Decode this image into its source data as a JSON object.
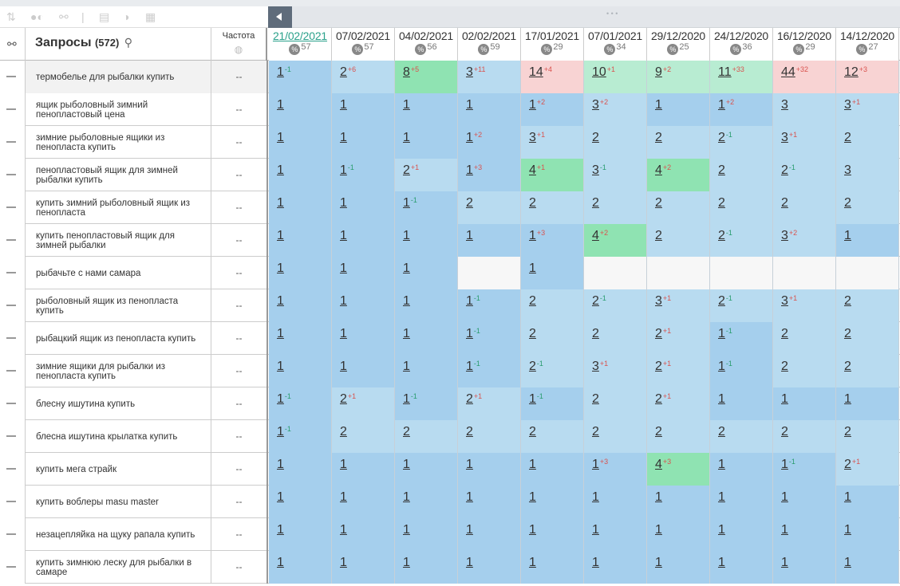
{
  "toolbar": {
    "icons": [
      "sort-icon",
      "toggle-icon",
      "link-icon",
      "table-icon",
      "contrast-icon",
      "text-icon"
    ]
  },
  "header": {
    "link_icon": "link-icon",
    "queries_label": "Запросы",
    "queries_count": "(572)",
    "frequency_label": "Частота",
    "frequency_icon": "globe-icon",
    "dates": [
      {
        "date": "21/02/2021",
        "num": "57",
        "active": true
      },
      {
        "date": "07/02/2021",
        "num": "57"
      },
      {
        "date": "04/02/2021",
        "num": "56"
      },
      {
        "date": "02/02/2021",
        "num": "59"
      },
      {
        "date": "17/01/2021",
        "num": "29"
      },
      {
        "date": "07/01/2021",
        "num": "34"
      },
      {
        "date": "29/12/2020",
        "num": "25"
      },
      {
        "date": "24/12/2020",
        "num": "36"
      },
      {
        "date": "16/12/2020",
        "num": "29"
      },
      {
        "date": "14/12/2020",
        "num": "27"
      }
    ]
  },
  "rows": [
    {
      "q": "термобелье для рыбалки купить",
      "f": "--",
      "cells": [
        [
          "1",
          "-1",
          "blue"
        ],
        [
          "2",
          "+6",
          "lblue"
        ],
        [
          "8",
          "+5",
          "green"
        ],
        [
          "3",
          "+11",
          "lblue"
        ],
        [
          "14",
          "+4",
          "pink"
        ],
        [
          "10",
          "+1",
          "lgreen"
        ],
        [
          "9",
          "+2",
          "lgreen"
        ],
        [
          "11",
          "+33",
          "lgreen"
        ],
        [
          "44",
          "+32",
          "pink"
        ],
        [
          "12",
          "+3",
          "pink"
        ]
      ]
    },
    {
      "q": "ящик рыболовный зимний пенопластовый цена",
      "f": "--",
      "cells": [
        [
          "1",
          "",
          "blue"
        ],
        [
          "1",
          "",
          "blue"
        ],
        [
          "1",
          "",
          "blue"
        ],
        [
          "1",
          "",
          "blue"
        ],
        [
          "1",
          "+2",
          "blue"
        ],
        [
          "3",
          "+2",
          "lblue"
        ],
        [
          "1",
          "",
          "blue"
        ],
        [
          "1",
          "+2",
          "blue"
        ],
        [
          "3",
          "",
          "lblue"
        ],
        [
          "3",
          "+1",
          "lblue"
        ]
      ]
    },
    {
      "q": "зимние рыболовные ящики из пенопласта купить",
      "f": "--",
      "cells": [
        [
          "1",
          "",
          "blue"
        ],
        [
          "1",
          "",
          "blue"
        ],
        [
          "1",
          "",
          "blue"
        ],
        [
          "1",
          "+2",
          "blue"
        ],
        [
          "3",
          "+1",
          "lblue"
        ],
        [
          "2",
          "",
          "lblue"
        ],
        [
          "2",
          "",
          "lblue"
        ],
        [
          "2",
          "-1",
          "lblue"
        ],
        [
          "3",
          "+1",
          "lblue"
        ],
        [
          "2",
          "",
          "lblue"
        ]
      ]
    },
    {
      "q": "пенопластовый ящик для зимней рыбалки купить",
      "f": "--",
      "cells": [
        [
          "1",
          "",
          "blue"
        ],
        [
          "1",
          "-1",
          "blue"
        ],
        [
          "2",
          "+1",
          "lblue"
        ],
        [
          "1",
          "+3",
          "blue"
        ],
        [
          "4",
          "+1",
          "green"
        ],
        [
          "3",
          "-1",
          "lblue"
        ],
        [
          "4",
          "+2",
          "green"
        ],
        [
          "2",
          "",
          "lblue"
        ],
        [
          "2",
          "-1",
          "lblue"
        ],
        [
          "3",
          "",
          "lblue"
        ]
      ]
    },
    {
      "q": "купить зимний рыболовный ящик из пенопласта",
      "f": "--",
      "cells": [
        [
          "1",
          "",
          "blue"
        ],
        [
          "1",
          "",
          "blue"
        ],
        [
          "1",
          "-1",
          "blue"
        ],
        [
          "2",
          "",
          "lblue"
        ],
        [
          "2",
          "",
          "lblue"
        ],
        [
          "2",
          "",
          "lblue"
        ],
        [
          "2",
          "",
          "lblue"
        ],
        [
          "2",
          "",
          "lblue"
        ],
        [
          "2",
          "",
          "lblue"
        ],
        [
          "2",
          "",
          "lblue"
        ]
      ]
    },
    {
      "q": "купить пенопластовый ящик для зимней рыбалки",
      "f": "--",
      "cells": [
        [
          "1",
          "",
          "blue"
        ],
        [
          "1",
          "",
          "blue"
        ],
        [
          "1",
          "",
          "blue"
        ],
        [
          "1",
          "",
          "blue"
        ],
        [
          "1",
          "+3",
          "blue"
        ],
        [
          "4",
          "+2",
          "green"
        ],
        [
          "2",
          "",
          "lblue"
        ],
        [
          "2",
          "-1",
          "lblue"
        ],
        [
          "3",
          "+2",
          "lblue"
        ],
        [
          "1",
          "",
          "blue"
        ]
      ]
    },
    {
      "q": "рыбачьте с нами самара",
      "f": "--",
      "cells": [
        [
          "1",
          "",
          "blue"
        ],
        [
          "1",
          "",
          "blue"
        ],
        [
          "1",
          "",
          "blue"
        ],
        [
          "",
          "",
          "empty"
        ],
        [
          "1",
          "",
          "blue"
        ],
        [
          "",
          "",
          "empty"
        ],
        [
          "",
          "",
          "empty"
        ],
        [
          "",
          "",
          "empty"
        ],
        [
          "",
          "",
          "empty"
        ],
        [
          "",
          "",
          "empty"
        ]
      ]
    },
    {
      "q": "рыболовный ящик из пенопласта купить",
      "f": "--",
      "cells": [
        [
          "1",
          "",
          "blue"
        ],
        [
          "1",
          "",
          "blue"
        ],
        [
          "1",
          "",
          "blue"
        ],
        [
          "1",
          "-1",
          "blue"
        ],
        [
          "2",
          "",
          "lblue"
        ],
        [
          "2",
          "-1",
          "lblue"
        ],
        [
          "3",
          "+1",
          "lblue"
        ],
        [
          "2",
          "-1",
          "lblue"
        ],
        [
          "3",
          "+1",
          "lblue"
        ],
        [
          "2",
          "",
          "lblue"
        ]
      ]
    },
    {
      "q": "рыбацкий ящик из пенопласта купить",
      "f": "--",
      "cells": [
        [
          "1",
          "",
          "blue"
        ],
        [
          "1",
          "",
          "blue"
        ],
        [
          "1",
          "",
          "blue"
        ],
        [
          "1",
          "-1",
          "blue"
        ],
        [
          "2",
          "",
          "lblue"
        ],
        [
          "2",
          "",
          "lblue"
        ],
        [
          "2",
          "+1",
          "lblue"
        ],
        [
          "1",
          "-1",
          "blue"
        ],
        [
          "2",
          "",
          "lblue"
        ],
        [
          "2",
          "",
          "lblue"
        ]
      ]
    },
    {
      "q": "зимние ящики для рыбалки из пенопласта купить",
      "f": "--",
      "cells": [
        [
          "1",
          "",
          "blue"
        ],
        [
          "1",
          "",
          "blue"
        ],
        [
          "1",
          "",
          "blue"
        ],
        [
          "1",
          "-1",
          "blue"
        ],
        [
          "2",
          "-1",
          "lblue"
        ],
        [
          "3",
          "+1",
          "lblue"
        ],
        [
          "2",
          "+1",
          "lblue"
        ],
        [
          "1",
          "-1",
          "blue"
        ],
        [
          "2",
          "",
          "lblue"
        ],
        [
          "2",
          "",
          "lblue"
        ]
      ]
    },
    {
      "q": "блесну ишутина купить",
      "f": "--",
      "cells": [
        [
          "1",
          "-1",
          "blue"
        ],
        [
          "2",
          "+1",
          "lblue"
        ],
        [
          "1",
          "-1",
          "blue"
        ],
        [
          "2",
          "+1",
          "lblue"
        ],
        [
          "1",
          "-1",
          "blue"
        ],
        [
          "2",
          "",
          "lblue"
        ],
        [
          "2",
          "+1",
          "lblue"
        ],
        [
          "1",
          "",
          "blue"
        ],
        [
          "1",
          "",
          "blue"
        ],
        [
          "1",
          "",
          "blue"
        ]
      ]
    },
    {
      "q": "блесна ишутина крылатка купить",
      "f": "--",
      "cells": [
        [
          "1",
          "-1",
          "blue"
        ],
        [
          "2",
          "",
          "lblue"
        ],
        [
          "2",
          "",
          "lblue"
        ],
        [
          "2",
          "",
          "lblue"
        ],
        [
          "2",
          "",
          "lblue"
        ],
        [
          "2",
          "",
          "lblue"
        ],
        [
          "2",
          "",
          "lblue"
        ],
        [
          "2",
          "",
          "lblue"
        ],
        [
          "2",
          "",
          "lblue"
        ],
        [
          "2",
          "",
          "lblue"
        ]
      ]
    },
    {
      "q": "купить мега страйк",
      "f": "--",
      "cells": [
        [
          "1",
          "",
          "blue"
        ],
        [
          "1",
          "",
          "blue"
        ],
        [
          "1",
          "",
          "blue"
        ],
        [
          "1",
          "",
          "blue"
        ],
        [
          "1",
          "",
          "blue"
        ],
        [
          "1",
          "+3",
          "blue"
        ],
        [
          "4",
          "+3",
          "green"
        ],
        [
          "1",
          "",
          "blue"
        ],
        [
          "1",
          "-1",
          "blue"
        ],
        [
          "2",
          "+1",
          "lblue"
        ]
      ]
    },
    {
      "q": "купить воблеры masu master",
      "f": "--",
      "cells": [
        [
          "1",
          "",
          "blue"
        ],
        [
          "1",
          "",
          "blue"
        ],
        [
          "1",
          "",
          "blue"
        ],
        [
          "1",
          "",
          "blue"
        ],
        [
          "1",
          "",
          "blue"
        ],
        [
          "1",
          "",
          "blue"
        ],
        [
          "1",
          "",
          "blue"
        ],
        [
          "1",
          "",
          "blue"
        ],
        [
          "1",
          "",
          "blue"
        ],
        [
          "1",
          "",
          "blue"
        ]
      ]
    },
    {
      "q": "незацепляйка на щуку рапала купить",
      "f": "--",
      "cells": [
        [
          "1",
          "",
          "blue"
        ],
        [
          "1",
          "",
          "blue"
        ],
        [
          "1",
          "",
          "blue"
        ],
        [
          "1",
          "",
          "blue"
        ],
        [
          "1",
          "",
          "blue"
        ],
        [
          "1",
          "",
          "blue"
        ],
        [
          "1",
          "",
          "blue"
        ],
        [
          "1",
          "",
          "blue"
        ],
        [
          "1",
          "",
          "blue"
        ],
        [
          "1",
          "",
          "blue"
        ]
      ]
    },
    {
      "q": "купить зимнюю леску для рыбалки в самаре",
      "f": "--",
      "cells": [
        [
          "1",
          "",
          "blue"
        ],
        [
          "1",
          "",
          "blue"
        ],
        [
          "1",
          "",
          "blue"
        ],
        [
          "1",
          "",
          "blue"
        ],
        [
          "1",
          "",
          "blue"
        ],
        [
          "1",
          "",
          "blue"
        ],
        [
          "1",
          "",
          "blue"
        ],
        [
          "1",
          "",
          "blue"
        ],
        [
          "1",
          "",
          "blue"
        ],
        [
          "1",
          "",
          "blue"
        ]
      ]
    }
  ]
}
